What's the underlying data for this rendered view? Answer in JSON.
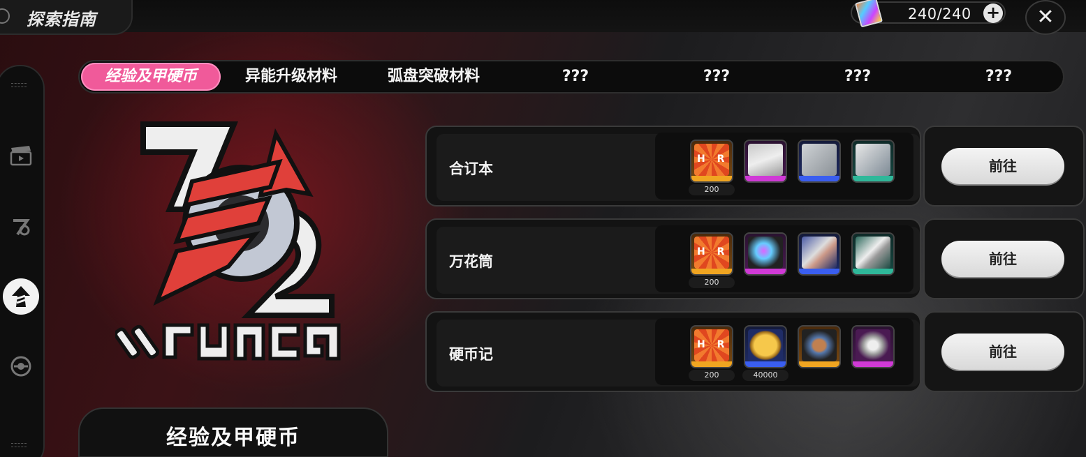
{
  "header": {
    "title": "探索指南",
    "energy": "240/240"
  },
  "tabs": [
    {
      "label": "经验及甲硬币",
      "active": true
    },
    {
      "label": "异能升级材料"
    },
    {
      "label": "弧盘突破材料"
    },
    {
      "label": "???"
    },
    {
      "label": "???"
    },
    {
      "label": "???"
    },
    {
      "label": "???"
    }
  ],
  "rail": {
    "icons": [
      "clapper-icon",
      "rank-icon",
      "upgrade-arrow-icon",
      "coin-icon"
    ]
  },
  "selected_category": "经验及甲硬币",
  "entries": [
    {
      "label": "合订本",
      "go_label": "前往",
      "items": [
        {
          "icon": "hunter-emblem-icon",
          "rarity": "orange",
          "count": "200"
        },
        {
          "icon": "tape-document-icon",
          "rarity": "purple"
        },
        {
          "icon": "document-stack-icon",
          "rarity": "blue"
        },
        {
          "icon": "book-stack-icon",
          "rarity": "green"
        }
      ]
    },
    {
      "label": "万花筒",
      "go_label": "前往",
      "items": [
        {
          "icon": "hunter-emblem-icon",
          "rarity": "orange",
          "count": "200"
        },
        {
          "icon": "kaleidoscope-tube-purple-icon",
          "rarity": "purple"
        },
        {
          "icon": "kaleidoscope-tube-blue-icon",
          "rarity": "blue"
        },
        {
          "icon": "kaleidoscope-tube-green-icon",
          "rarity": "green"
        }
      ]
    },
    {
      "label": "硬币记",
      "go_label": "前往",
      "items": [
        {
          "icon": "hunter-emblem-icon",
          "rarity": "orange",
          "count": "200"
        },
        {
          "icon": "gold-coin-icon",
          "rarity": "blue",
          "count": "40000"
        },
        {
          "icon": "spool-icon",
          "rarity": "orange"
        },
        {
          "icon": "silver-spool-icon",
          "rarity": "purple"
        }
      ]
    }
  ],
  "colors": {
    "tab_active": "#f05a9a",
    "rarity_orange": "#f0a521",
    "rarity_purple": "#d03ad6",
    "rarity_blue": "#3a5ef0",
    "rarity_green": "#2fb89a",
    "logo_red": "#e0403a"
  }
}
